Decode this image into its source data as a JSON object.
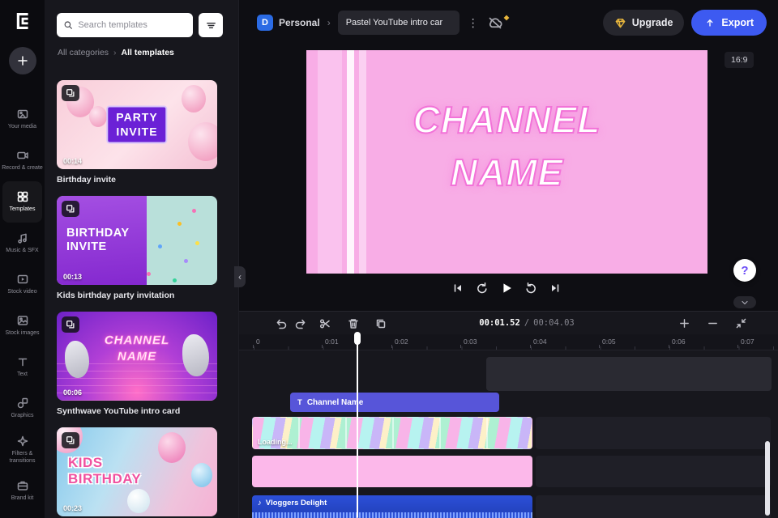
{
  "colors": {
    "accent_blue": "#3d5af1",
    "upgrade_gold": "#e8b63c",
    "canvas_pink": "#f8ade6",
    "title_stroke_pink": "#f273d8",
    "text_clip_purple": "#5755d9",
    "audio_clip_blue": "#2c4fd8",
    "pink_clip": "#fcb8ea"
  },
  "sidebar": {
    "items": [
      {
        "label": "Your media"
      },
      {
        "label": "Record & create"
      },
      {
        "label": "Templates",
        "active": true
      },
      {
        "label": "Music & SFX"
      },
      {
        "label": "Stock video"
      },
      {
        "label": "Stock images"
      },
      {
        "label": "Text"
      },
      {
        "label": "Graphics"
      },
      {
        "label": "Filters & transitions"
      },
      {
        "label": "Brand kit"
      }
    ]
  },
  "panel": {
    "search_placeholder": "Search templates",
    "breadcrumb": {
      "parent": "All categories",
      "separator": "›",
      "current": "All templates"
    },
    "cards": [
      {
        "line1": "PARTY",
        "line2": "INVITE",
        "duration": "00:14",
        "caption": "Birthday invite"
      },
      {
        "line1": "BIRTHDAY",
        "line2": "INVITE",
        "duration": "00:13",
        "caption": "Kids birthday party invitation"
      },
      {
        "line1": "CHANNEL",
        "line2": "NAME",
        "duration": "00:06",
        "caption": "Synthwave YouTube intro card"
      },
      {
        "line1": "KIDS",
        "line2": "BIRTHDAY",
        "duration": "00:23",
        "caption": ""
      }
    ],
    "collapse_glyph": "‹"
  },
  "header": {
    "workspace_initial": "D",
    "workspace_name": "Personal",
    "breadcrumb_separator": "›",
    "project_title": "Pastel YouTube intro car",
    "menu_glyph": "⋮",
    "upgrade_label": "Upgrade",
    "export_label": "Export"
  },
  "preview": {
    "aspect_ratio": "16:9",
    "line1": "CHANNEL",
    "line2": "NAME",
    "help_label": "?"
  },
  "timeline": {
    "current_time": "00:01.52",
    "time_separator": "/",
    "total_time": "00:04.03",
    "ruler_labels": [
      "0",
      "0:01",
      "0:02",
      "0:03",
      "0:04",
      "0:05",
      "0:06",
      "0:07"
    ],
    "text_clip": {
      "icon": "T",
      "label": "Channel Name"
    },
    "video_clip": {
      "status": "Loading..."
    },
    "audio_clip": {
      "icon": "♪",
      "label": "Vloggers Delight"
    }
  }
}
